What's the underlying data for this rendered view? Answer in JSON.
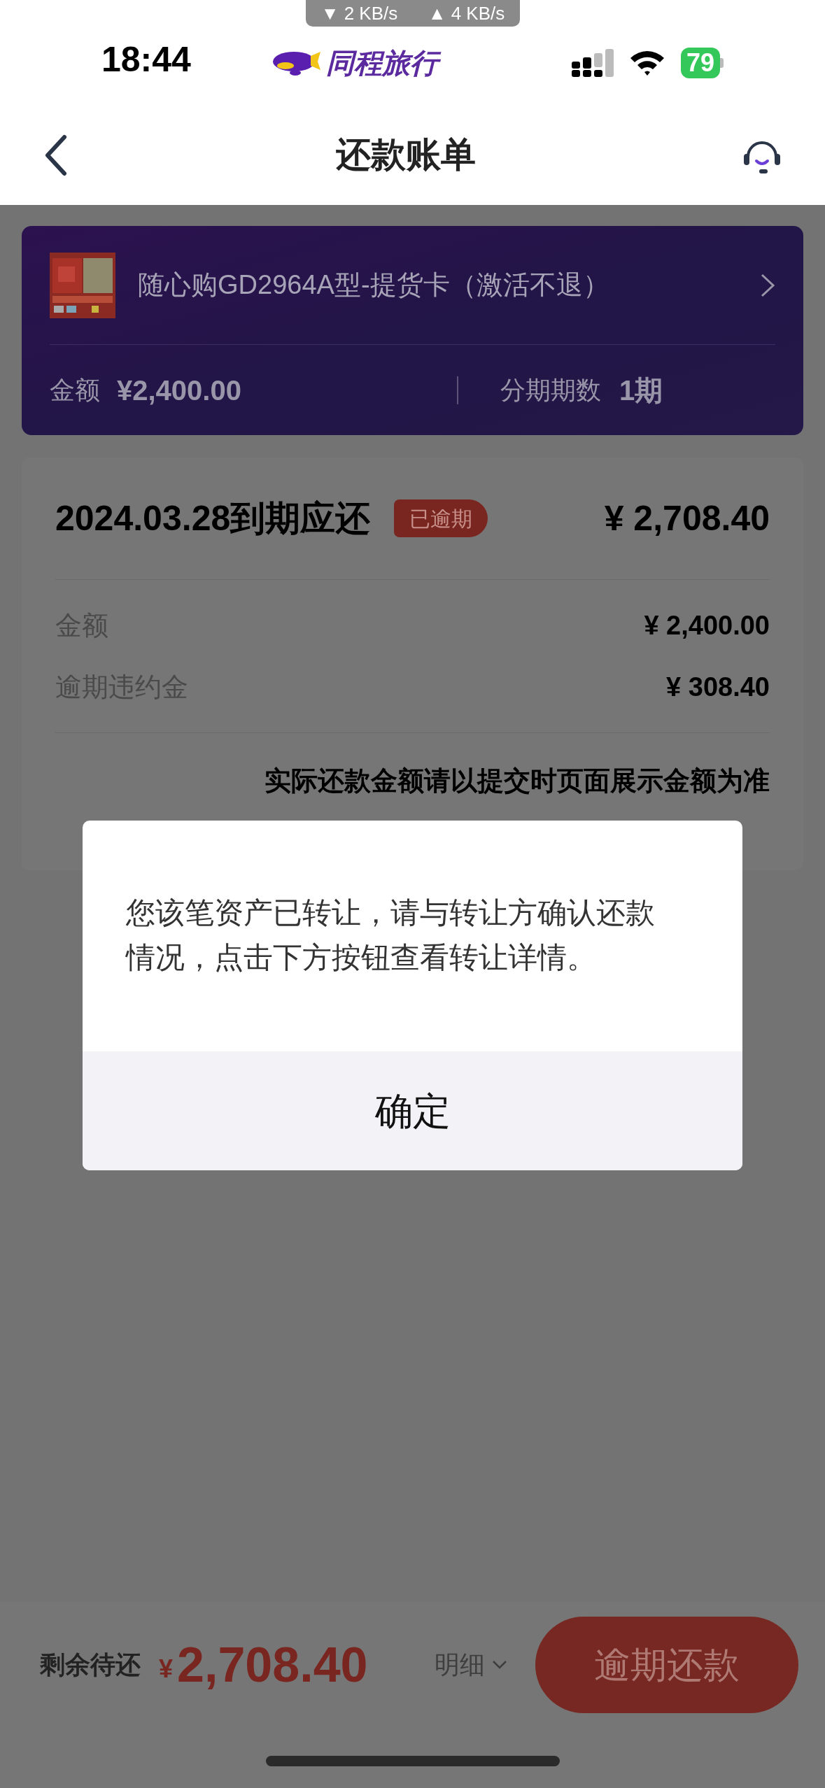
{
  "network_pill": {
    "download": "▼ 2 KB/s",
    "upload": "▲ 4 KB/s"
  },
  "status_bar": {
    "time": "18:44",
    "app_name": "同程旅行",
    "battery": "79"
  },
  "nav": {
    "title": "还款账单"
  },
  "product": {
    "name": "随心购GD2964A型-提货卡（激活不退）",
    "amount_label": "金额",
    "amount": "¥2,400.00",
    "periods_label": "分期期数",
    "periods": "1期"
  },
  "bill": {
    "due": "2024.03.28到期应还",
    "badge": "已逾期",
    "total": "¥ 2,708.40",
    "rows": [
      {
        "label": "金额",
        "value": "¥ 2,400.00"
      },
      {
        "label": "逾期违约金",
        "value": "¥ 308.40"
      }
    ],
    "note": "实际还款金额请以提交时页面展示金额为准"
  },
  "dialog": {
    "message": "您该笔资产已转让，请与转让方确认还款情况，点击下方按钮查看转让详情。",
    "button": "确定"
  },
  "footer": {
    "label": "剩余待还",
    "currency": "¥",
    "amount": "2,708.40",
    "detail": "明细",
    "button": "逾期还款"
  }
}
